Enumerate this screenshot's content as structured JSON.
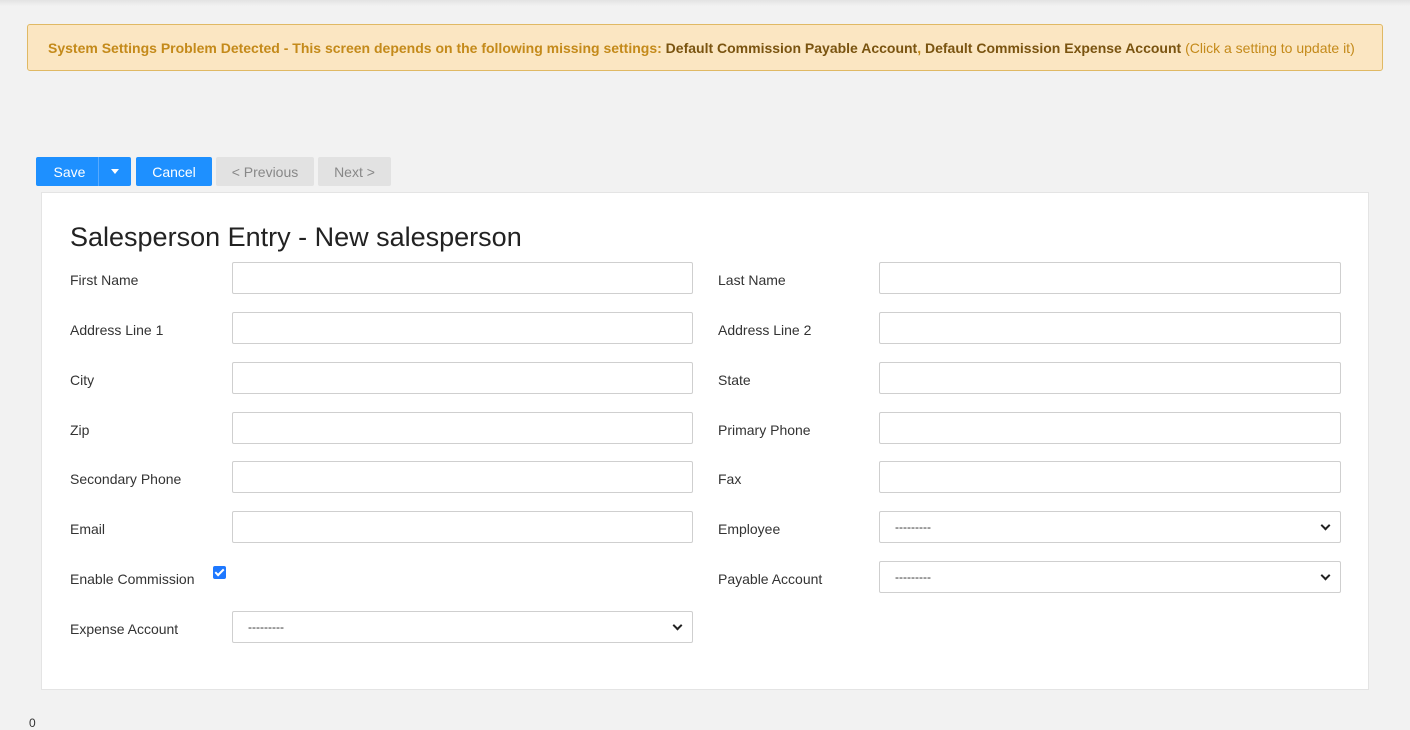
{
  "alert": {
    "prefix": "System Settings Problem Detected - This screen depends on the following missing settings:",
    "link1": "Default Commission Payable Account",
    "separator": ",",
    "link2": "Default Commission Expense Account",
    "hint": "(Click a setting to update it)"
  },
  "toolbar": {
    "save_label": "Save",
    "cancel_label": "Cancel",
    "previous_label": "< Previous",
    "next_label": "Next >"
  },
  "form": {
    "title": "Salesperson Entry - New salesperson",
    "first_name_label": "First Name",
    "first_name_value": "",
    "last_name_label": "Last Name",
    "last_name_value": "",
    "address1_label": "Address Line 1",
    "address1_value": "",
    "address2_label": "Address Line 2",
    "address2_value": "",
    "city_label": "City",
    "city_value": "",
    "state_label": "State",
    "state_value": "",
    "zip_label": "Zip",
    "zip_value": "",
    "primary_phone_label": "Primary Phone",
    "primary_phone_value": "",
    "secondary_phone_label": "Secondary Phone",
    "secondary_phone_value": "",
    "fax_label": "Fax",
    "fax_value": "",
    "email_label": "Email",
    "email_value": "",
    "employee_label": "Employee",
    "employee_selected": "---------",
    "enable_commission_label": "Enable Commission",
    "enable_commission_checked": true,
    "payable_account_label": "Payable Account",
    "payable_account_selected": "---------",
    "expense_account_label": "Expense Account",
    "expense_account_selected": "---------"
  },
  "colors": {
    "primary": "#1e90ff",
    "alert_bg": "#fbe6c2",
    "alert_text": "#c48a1a"
  },
  "footer": {
    "text": "0"
  }
}
